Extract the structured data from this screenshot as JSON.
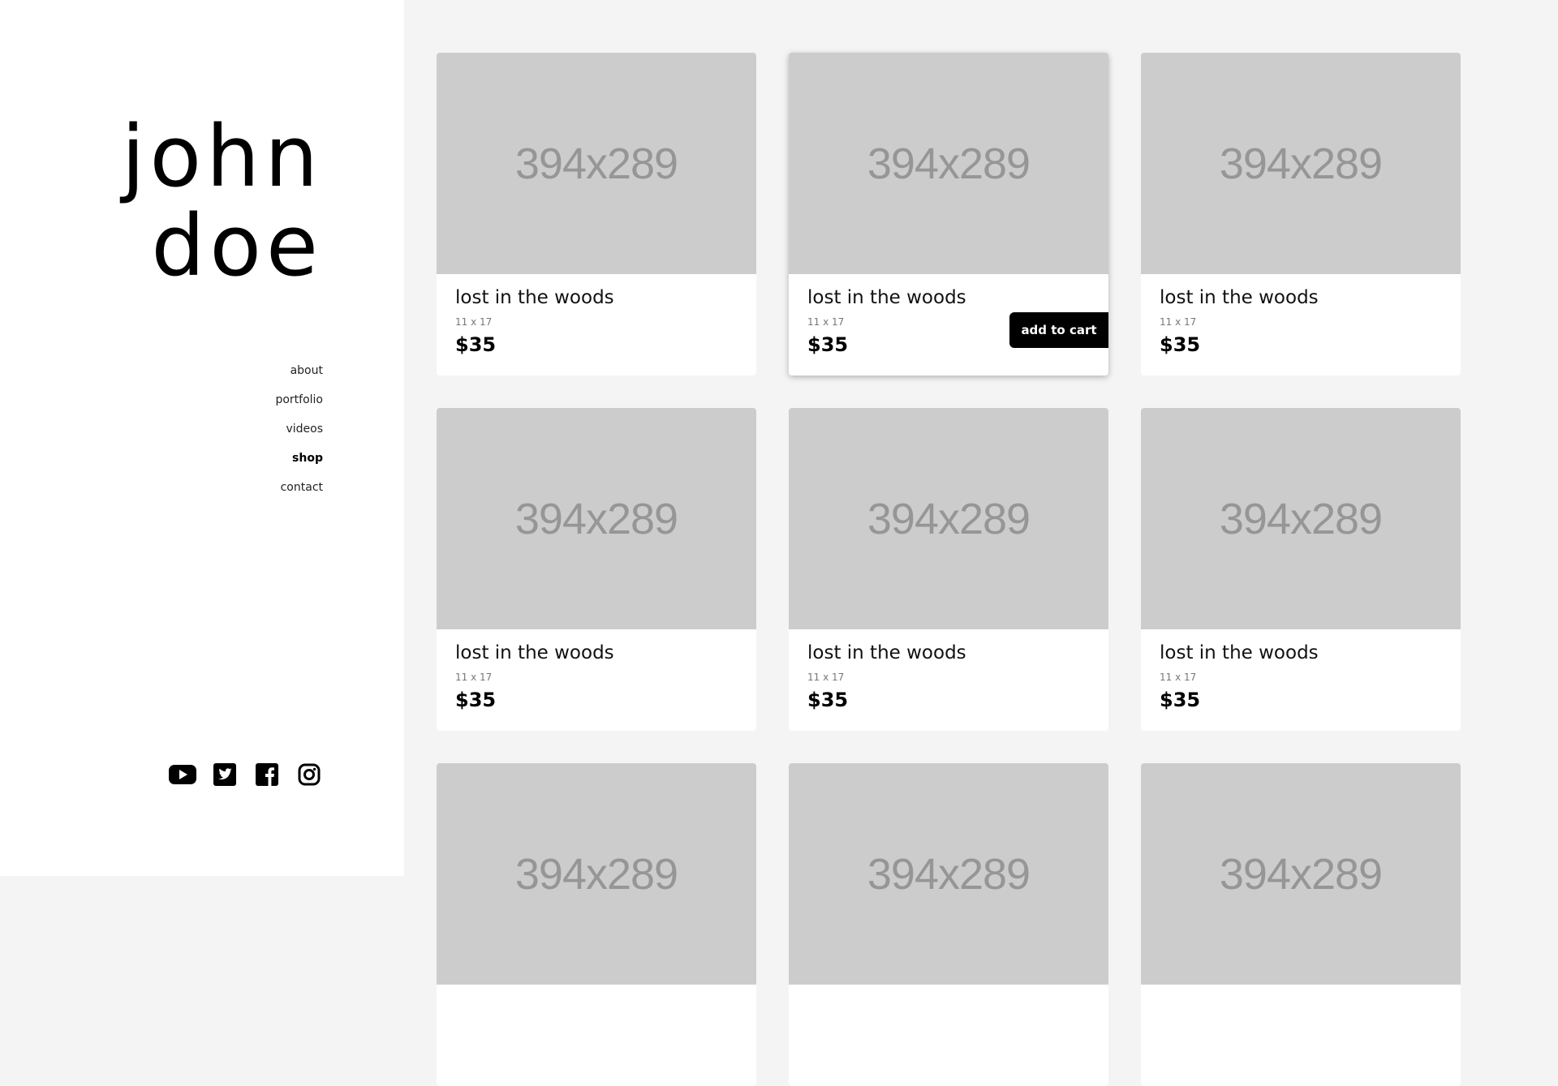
{
  "brand": {
    "line1": "john",
    "line2": "doe"
  },
  "nav": {
    "items": [
      {
        "label": "about"
      },
      {
        "label": "portfolio"
      },
      {
        "label": "videos"
      },
      {
        "label": "shop",
        "active": true
      },
      {
        "label": "contact"
      }
    ]
  },
  "social": [
    "youtube-icon",
    "twitter-icon",
    "facebook-icon",
    "instagram-icon"
  ],
  "colors": {
    "sidebar_bg": "#ffffff",
    "page_bg": "#f4f4f4",
    "placeholder": "#cccccc",
    "placeholder_text": "#969696",
    "button_bg": "#000000"
  },
  "products": [
    {
      "image_label": "394x289",
      "title": "lost in the woods",
      "size": "11 x 17",
      "price": "$35"
    },
    {
      "image_label": "394x289",
      "title": "lost in the woods",
      "size": "11 x 17",
      "price": "$35",
      "button": "add to cart"
    },
    {
      "image_label": "394x289",
      "title": "lost in the woods",
      "size": "11 x 17",
      "price": "$35"
    },
    {
      "image_label": "394x289",
      "title": "lost in the woods",
      "size": "11 x 17",
      "price": "$35"
    },
    {
      "image_label": "394x289",
      "title": "lost in the woods",
      "size": "11 x 17",
      "price": "$35"
    },
    {
      "image_label": "394x289",
      "title": "lost in the woods",
      "size": "11 x 17",
      "price": "$35"
    },
    {
      "image_label": "394x289"
    },
    {
      "image_label": "394x289"
    },
    {
      "image_label": "394x289"
    }
  ]
}
